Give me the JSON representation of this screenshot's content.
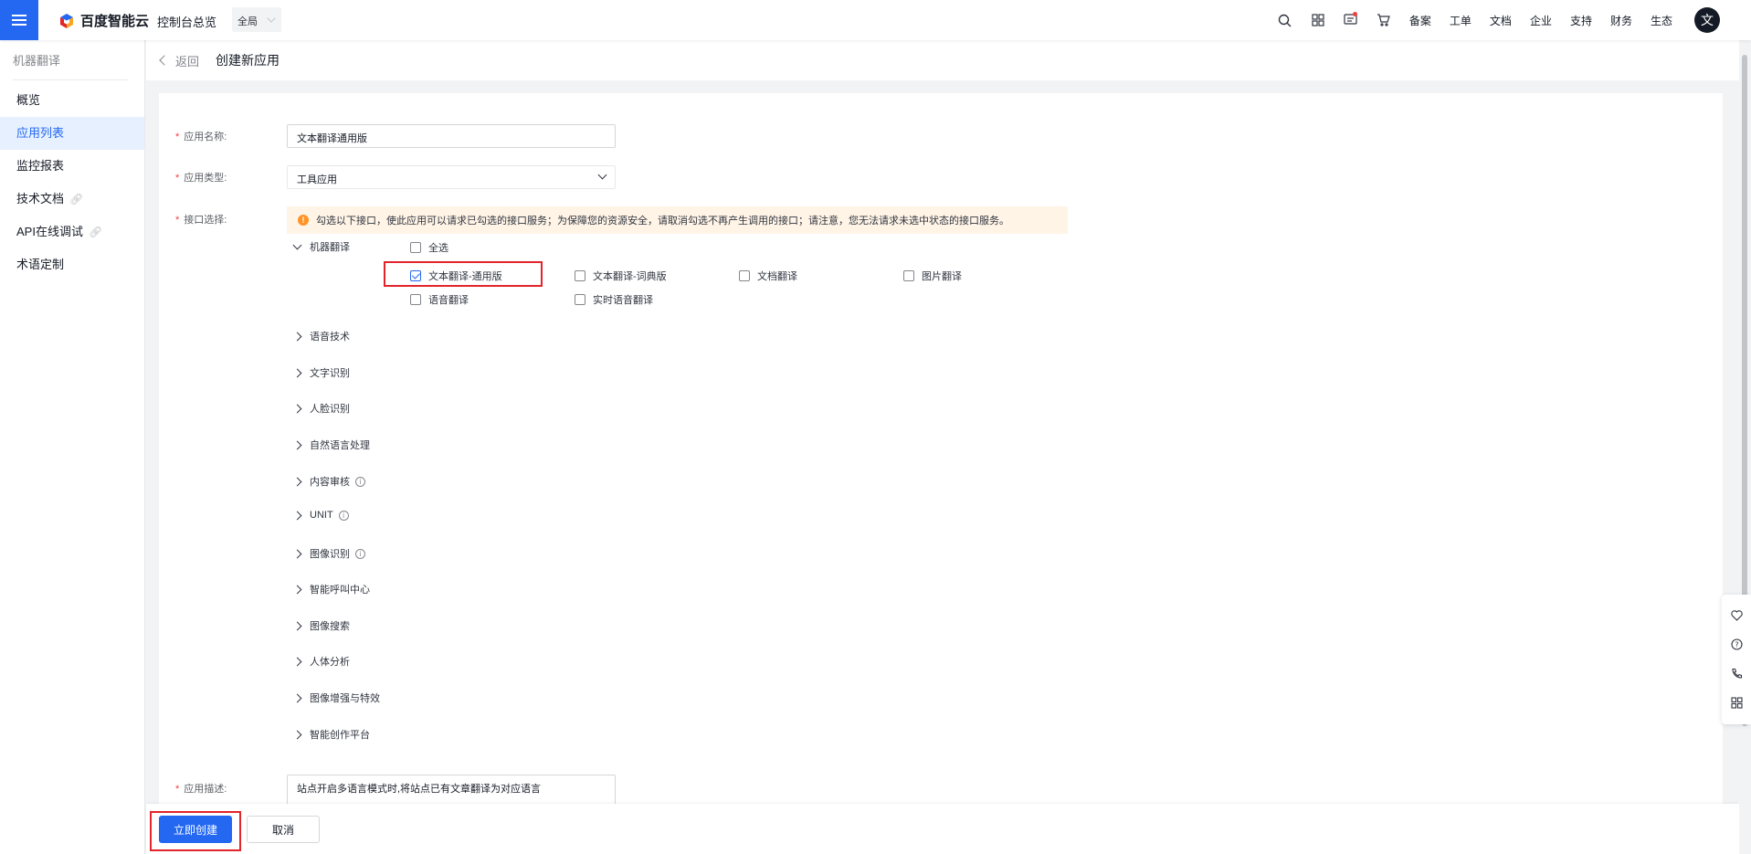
{
  "topbar": {
    "brand": "百度智能云",
    "overview": "控制台总览",
    "region": "全局",
    "links": [
      "备案",
      "工单",
      "文档",
      "企业",
      "支持",
      "财务",
      "生态"
    ],
    "avatar": "文"
  },
  "sidebar": {
    "title": "机器翻译",
    "items": [
      {
        "label": "概览",
        "active": false
      },
      {
        "label": "应用列表",
        "active": true
      },
      {
        "label": "监控报表",
        "active": false
      },
      {
        "label": "技术文档",
        "active": false,
        "external": true
      },
      {
        "label": "API在线调试",
        "active": false,
        "external": true
      },
      {
        "label": "术语定制",
        "active": false
      }
    ]
  },
  "header": {
    "back": "返回",
    "title": "创建新应用"
  },
  "form": {
    "name_label": "应用名称:",
    "name_value": "文本翻译通用版",
    "type_label": "应用类型:",
    "type_value": "工具应用",
    "api_label": "接口选择:",
    "notice": "勾选以下接口，使此应用可以请求已勾选的接口服务；为保障您的资源安全，请取消勾选不再产生调用的接口；请注意，您无法请求未选中状态的接口服务。",
    "expanded_group": "机器翻译",
    "select_all": "全选",
    "options": [
      {
        "label": "文本翻译-通用版",
        "checked": true
      },
      {
        "label": "文本翻译-词典版",
        "checked": false
      },
      {
        "label": "文档翻译",
        "checked": false
      },
      {
        "label": "图片翻译",
        "checked": false
      },
      {
        "label": "语音翻译",
        "checked": false
      },
      {
        "label": "实时语音翻译",
        "checked": false
      }
    ],
    "groups": [
      {
        "label": "语音技术",
        "info": false
      },
      {
        "label": "文字识别",
        "info": false
      },
      {
        "label": "人脸识别",
        "info": false
      },
      {
        "label": "自然语言处理",
        "info": false
      },
      {
        "label": "内容审核",
        "info": true
      },
      {
        "label": "UNIT",
        "info": true
      },
      {
        "label": "图像识别",
        "info": true
      },
      {
        "label": "智能呼叫中心",
        "info": false
      },
      {
        "label": "图像搜索",
        "info": false
      },
      {
        "label": "人体分析",
        "info": false
      },
      {
        "label": "图像增强与特效",
        "info": false
      },
      {
        "label": "智能创作平台",
        "info": false
      }
    ],
    "desc_label": "应用描述:",
    "desc_value": "站点开启多语言模式时,将站点已有文章翻译为对应语言"
  },
  "footer": {
    "create": "立即创建",
    "cancel": "取消"
  },
  "colors": {
    "primary": "#2468f2",
    "highlight": "#e2242b",
    "notice_bg": "#fff4e6"
  }
}
